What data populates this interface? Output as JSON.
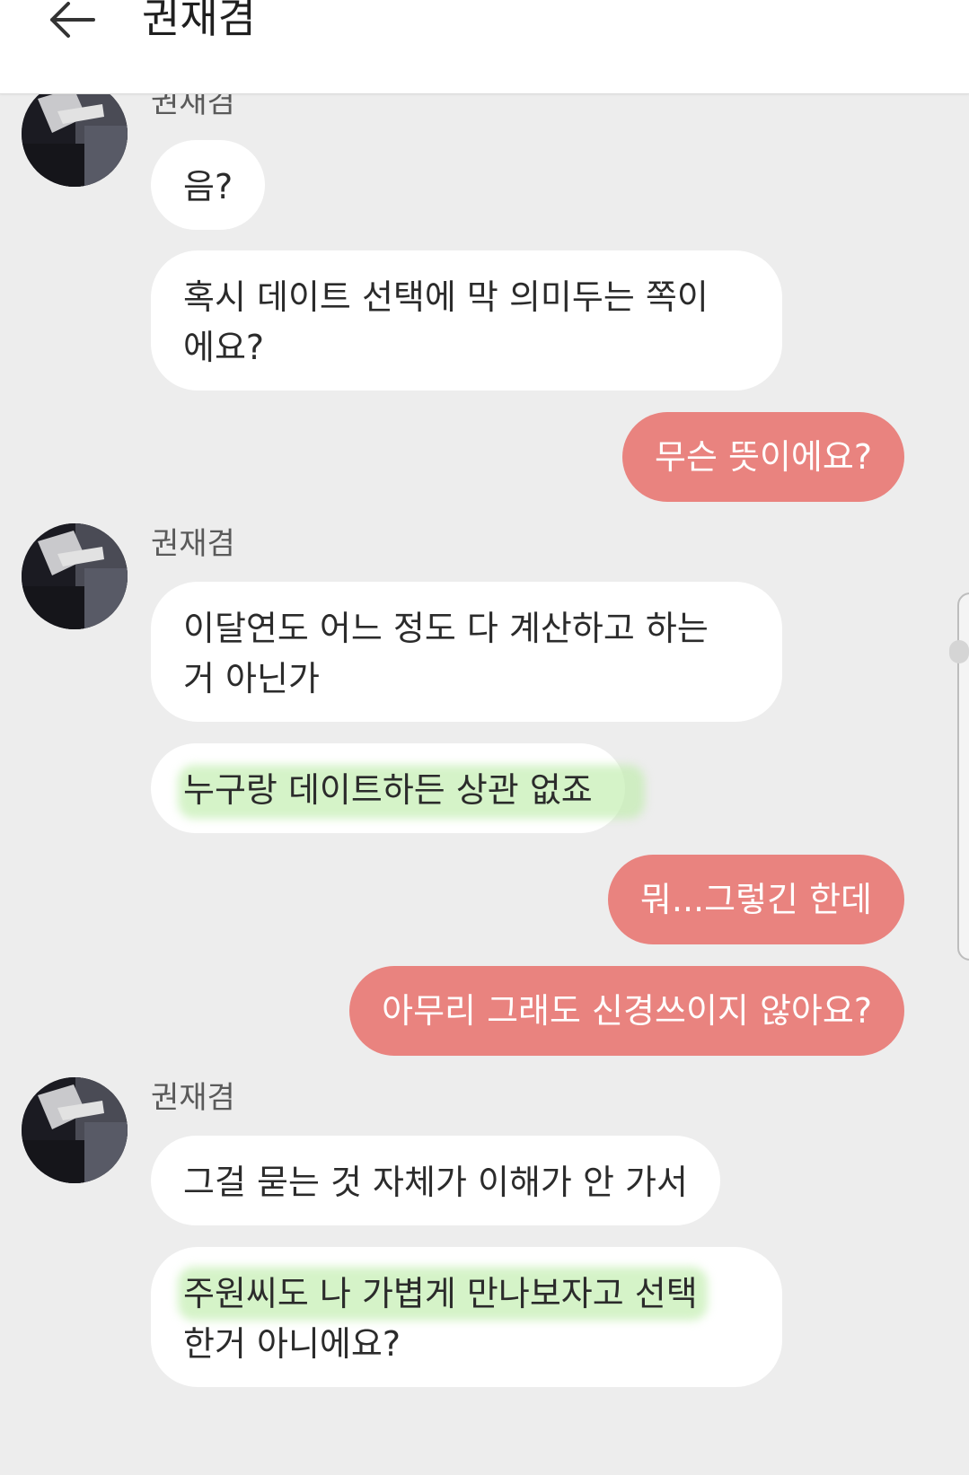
{
  "header": {
    "title": "권재겸",
    "back_icon": "arrow-left-icon"
  },
  "messages": [
    {
      "direction": "in",
      "sender": "권재겸",
      "lines": [
        "음?"
      ]
    },
    {
      "direction": "in",
      "lines": [
        "혹시 데이트 선택에 막 의미두는 쪽이",
        "에요?"
      ]
    },
    {
      "direction": "out",
      "lines": [
        "무슨 뜻이에요?"
      ]
    },
    {
      "direction": "in",
      "sender": "권재겸",
      "lines": [
        "이달연도 어느 정도 다 계산하고 하는",
        "거 아닌가"
      ]
    },
    {
      "direction": "in",
      "lines": [
        "누구랑 데이트하든 상관 없죠"
      ],
      "highlighted": true
    },
    {
      "direction": "out",
      "lines": [
        "뭐...그렇긴 한데"
      ]
    },
    {
      "direction": "out",
      "lines": [
        "아무리 그래도 신경쓰이지 않아요?"
      ]
    },
    {
      "direction": "in",
      "sender": "권재겸",
      "lines": [
        "그걸 묻는 것 자체가 이해가 안 가서"
      ]
    },
    {
      "direction": "in",
      "lines": [
        "주원씨도 나 가볍게 만나보자고 선택",
        "한거 아니에요?"
      ],
      "highlighted": true
    }
  ],
  "colors": {
    "outgoing_bubble": "#e9837f",
    "incoming_bubble": "#ffffff",
    "background": "#ededed",
    "highlight": "#bfecab"
  }
}
